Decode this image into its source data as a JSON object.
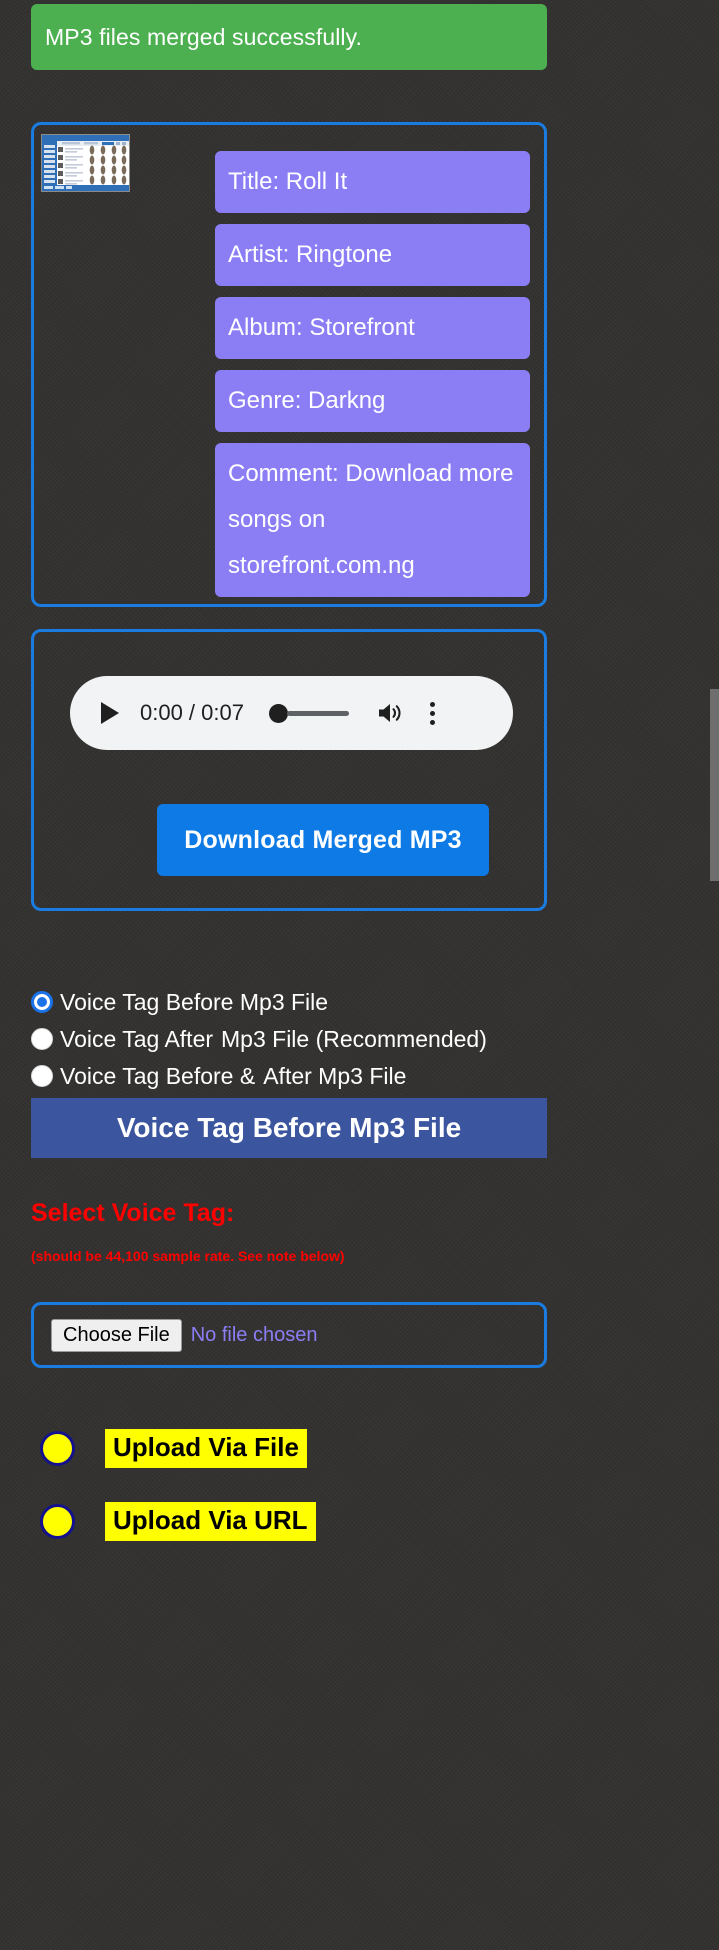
{
  "alert": {
    "message": "MP3 files merged successfully.",
    "color": "#4caf50"
  },
  "metadata_panel": {
    "thumbnail_name": "album-art-screenshot",
    "fields": [
      {
        "label": "Title",
        "text": "Title: Roll It"
      },
      {
        "label": "Artist",
        "text": "Artist: Ringtone"
      },
      {
        "label": "Album",
        "text": "Album: Storefront"
      },
      {
        "label": "Genre",
        "text": "Genre: Darkng"
      },
      {
        "label": "Comment",
        "text": "Comment: Download more songs on storefront.com.ng"
      }
    ],
    "chip_color": "#8b7ef5",
    "border_color": "#1a7ce0"
  },
  "player": {
    "current_time": "0:00",
    "duration": "0:07",
    "time_display": "0:00 / 0:07",
    "play_icon": "play-icon",
    "volume_icon": "volume-high-icon",
    "menu_icon": "more-vertical-icon",
    "download_label": "Download Merged MP3",
    "download_color": "#0d7ae5"
  },
  "voice_tag_position": {
    "options": [
      {
        "label": "Voice Tag Before Mp3 File",
        "selected": true
      },
      {
        "label": "Voice Tag After Mp3 File (Recommended)",
        "selected": false
      },
      {
        "label": "Voice Tag Before & After Mp3 File",
        "selected": false
      }
    ],
    "option_1_label": "Voice Tag Before Mp3 File",
    "option_2_label_part1": "Voice Tag After",
    "option_2_label_part2": "Mp3 File (Recommended)",
    "option_3_label_part1": "Voice Tag Before &",
    "option_3_label_part2": "After Mp3 File"
  },
  "mode_bar": {
    "title": "Voice Tag Before Mp3 File",
    "color": "#3b559f"
  },
  "select_voice_tag": {
    "heading": "Select Voice Tag:",
    "note": "(should be 44,100 sample rate. See note below)",
    "color": "#ff0000"
  },
  "file_input": {
    "button_label": "Choose File",
    "status_text": "No file chosen"
  },
  "upload_method": {
    "options": [
      {
        "label": "Upload Via File",
        "selected": false
      },
      {
        "label": "Upload Via URL",
        "selected": false
      }
    ],
    "radio_fill": "#ffff00",
    "radio_border": "#13118e",
    "tag_background": "#ffff00"
  }
}
